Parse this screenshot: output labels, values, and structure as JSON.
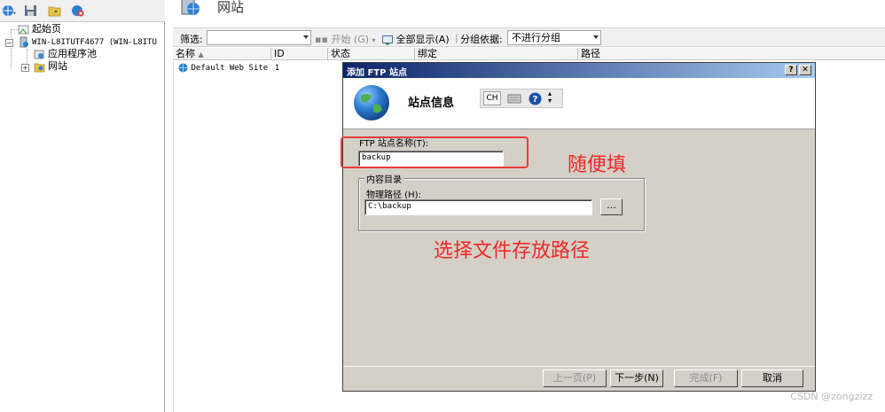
{
  "tree": {
    "start_page": "起始页",
    "server_node": "WIN-L8ITUTF4677 (WIN-L8ITU",
    "app_pools": "应用程序池",
    "sites": "网站"
  },
  "page": {
    "title": "网站"
  },
  "filterbar": {
    "filter_label": "筛选:",
    "start_label": "开始 (G)",
    "show_all_label": "全部显示(A)",
    "group_by_label": "分组依据:",
    "group_by_value": "不进行分组"
  },
  "columns": [
    "名称",
    "ID",
    "状态",
    "绑定",
    "路径"
  ],
  "rows": [
    {
      "name": "Default Web Site",
      "id": "1"
    }
  ],
  "dialog": {
    "title": "添加 FTP 站点",
    "help_btn": "?",
    "close_btn": "✕",
    "header_title": "站点信息",
    "lang_badge": "CH",
    "site_name_label": "FTP 站点名称(T):",
    "site_name_value": "backup",
    "content_dir_label": "内容目录",
    "physical_path_label": "物理路径 (H):",
    "physical_path_value": "C:\\backup",
    "browse_btn": "...",
    "buttons": {
      "prev": "上一页(P)",
      "next": "下一步(N)",
      "finish": "完成(F)",
      "cancel": "取消"
    }
  },
  "annotations": {
    "fill_freely": "随便填",
    "choose_path": "选择文件存放路径"
  },
  "watermark": "CSDN @zongzizz",
  "colors": {
    "annotation_red": "#f02828",
    "title_gradient_start": "#0a246a",
    "title_gradient_end": "#a6caf0",
    "dialog_face": "#d4d0c8"
  }
}
